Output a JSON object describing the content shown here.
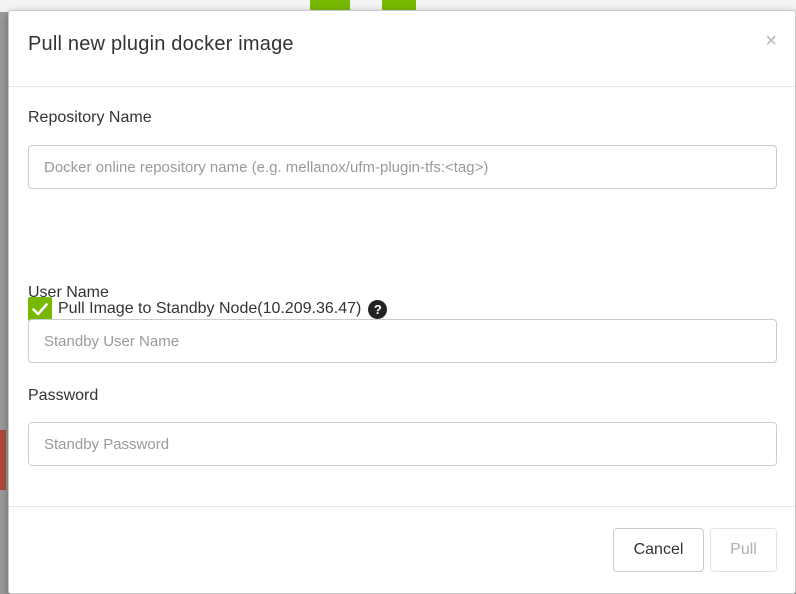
{
  "dialog": {
    "title": "Pull new plugin docker image",
    "close_symbol": "×"
  },
  "repository": {
    "label": "Repository Name",
    "value": "",
    "placeholder": "Docker online repository name (e.g. mellanox/ufm-plugin-tfs:<tag>)"
  },
  "standby_checkbox": {
    "checked": true,
    "label": "Pull Image to Standby Node(10.209.36.47)",
    "help_icon": "question-circle-icon",
    "help_glyph": "?"
  },
  "username": {
    "label": "User Name",
    "value": "",
    "placeholder": "Standby User Name"
  },
  "password": {
    "label": "Password",
    "value": "",
    "placeholder": "Standby Password"
  },
  "footer": {
    "cancel_label": "Cancel",
    "pull_label": "Pull",
    "pull_disabled": true
  },
  "colors": {
    "accent": "#76b900",
    "border": "#cccccc",
    "disabled_text": "#b0b0b0"
  }
}
